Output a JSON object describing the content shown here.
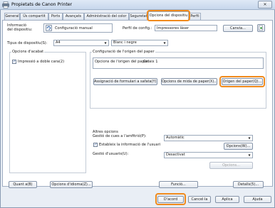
{
  "window": {
    "title": "Propietats de Canon Printer",
    "close_label": "✕"
  },
  "tabs": [
    {
      "label": "General"
    },
    {
      "label": "Ús compartit"
    },
    {
      "label": "Ports"
    },
    {
      "label": "Avançats"
    },
    {
      "label": "Administració del color"
    },
    {
      "label": "Seguretat"
    },
    {
      "label": "Opcions del dispositiu"
    },
    {
      "label": "Perfil"
    }
  ],
  "device_info": {
    "label": "Informació del dispositiu:",
    "value": "Configuració manual",
    "config_profile_label": "Perfil de config.:",
    "config_profile_value": "Impressores làser",
    "change_button": "Canvia..."
  },
  "device_type": {
    "label": "Tipus de dispositiu(S):",
    "paper_size": "A4",
    "color_mode": "Blanc i negre"
  },
  "finishing": {
    "title": "Opcions d'acabat",
    "duplex_label": "Impressió a doble cara(2)",
    "duplex_checked": true
  },
  "paper_source": {
    "title": "Configuració de l'origen del paper",
    "source_option_label": "Opcions de l'origen del paper:",
    "source_option_value": "Calaix 1",
    "assign_forms_button": "Assignació de formulari a safata(Y)...",
    "paper_size_options_button": "Opcions de mida de paper(X)...",
    "paper_source_button": "Origen del paper(Q)..."
  },
  "other_options": {
    "title": "Altres opcions",
    "queue_mgmt_label": "Gestió de cues a l'amfitrió(P):",
    "queue_mgmt_value": "Automàtic",
    "user_info_label": "Estableix la informació de l'usuari",
    "user_info_checked": true,
    "options_button": "Opcions(W)...",
    "user_mgmt_label": "Gestió d'usuaris(U):",
    "user_mgmt_value": "Desactivat",
    "options_disabled_button": "Opcions..."
  },
  "bottom_row": {
    "about_button": "Quant a(B)",
    "language_options_button": "Opcions d'idioma(Z)...",
    "functions_button": "Funció...",
    "details_button": "Detalls(5)..."
  },
  "dialog_buttons": {
    "ok": "D'acord",
    "cancel": "Cancel·la",
    "apply": "Aplica",
    "help": "Ajuda"
  }
}
